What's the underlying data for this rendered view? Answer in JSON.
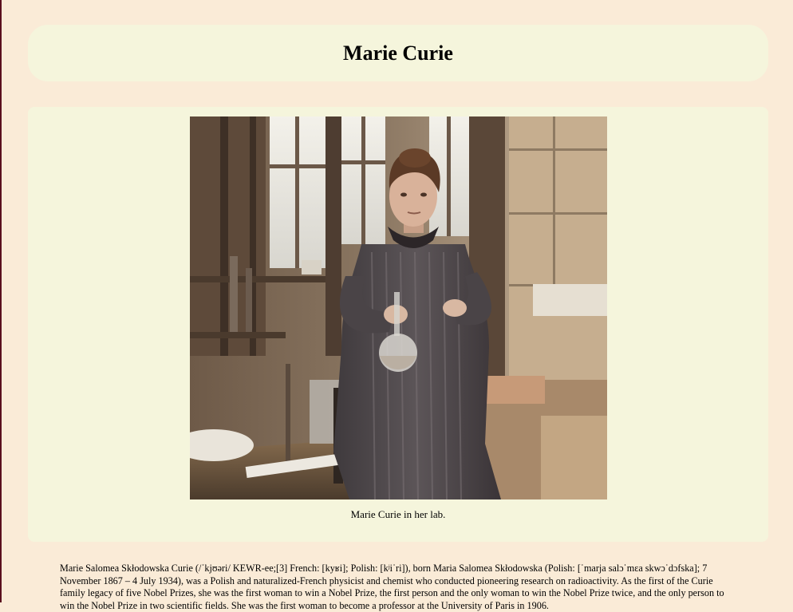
{
  "page": {
    "title": "Marie Curie"
  },
  "figure": {
    "image_alt": "Marie Curie in her lab.",
    "caption": "Marie Curie in her lab."
  },
  "bio": {
    "text": "Marie Salomea Skłodowska Curie (/ˈkjʊəri/ KEWR-ee;[3] French: [kyʁi]; Polish: [kʲiˈri]), born Maria Salomea Skłodowska (Polish: [ˈmarja salɔˈmɛa skwɔˈdɔfska]; 7 November 1867 – 4 July 1934), was a Polish and naturalized-French physicist and chemist who conducted pioneering research on radioactivity. As the first of the Curie family legacy of five Nobel Prizes, she was the first woman to win a Nobel Prize, the first person and the only woman to win the Nobel Prize twice, and the only person to win the Nobel Prize in two scientific fields. She was the first woman to become a professor at the University of Paris in 1906."
  },
  "colors": {
    "page_background": "#faebd7",
    "card_background": "#f5f5dc"
  }
}
